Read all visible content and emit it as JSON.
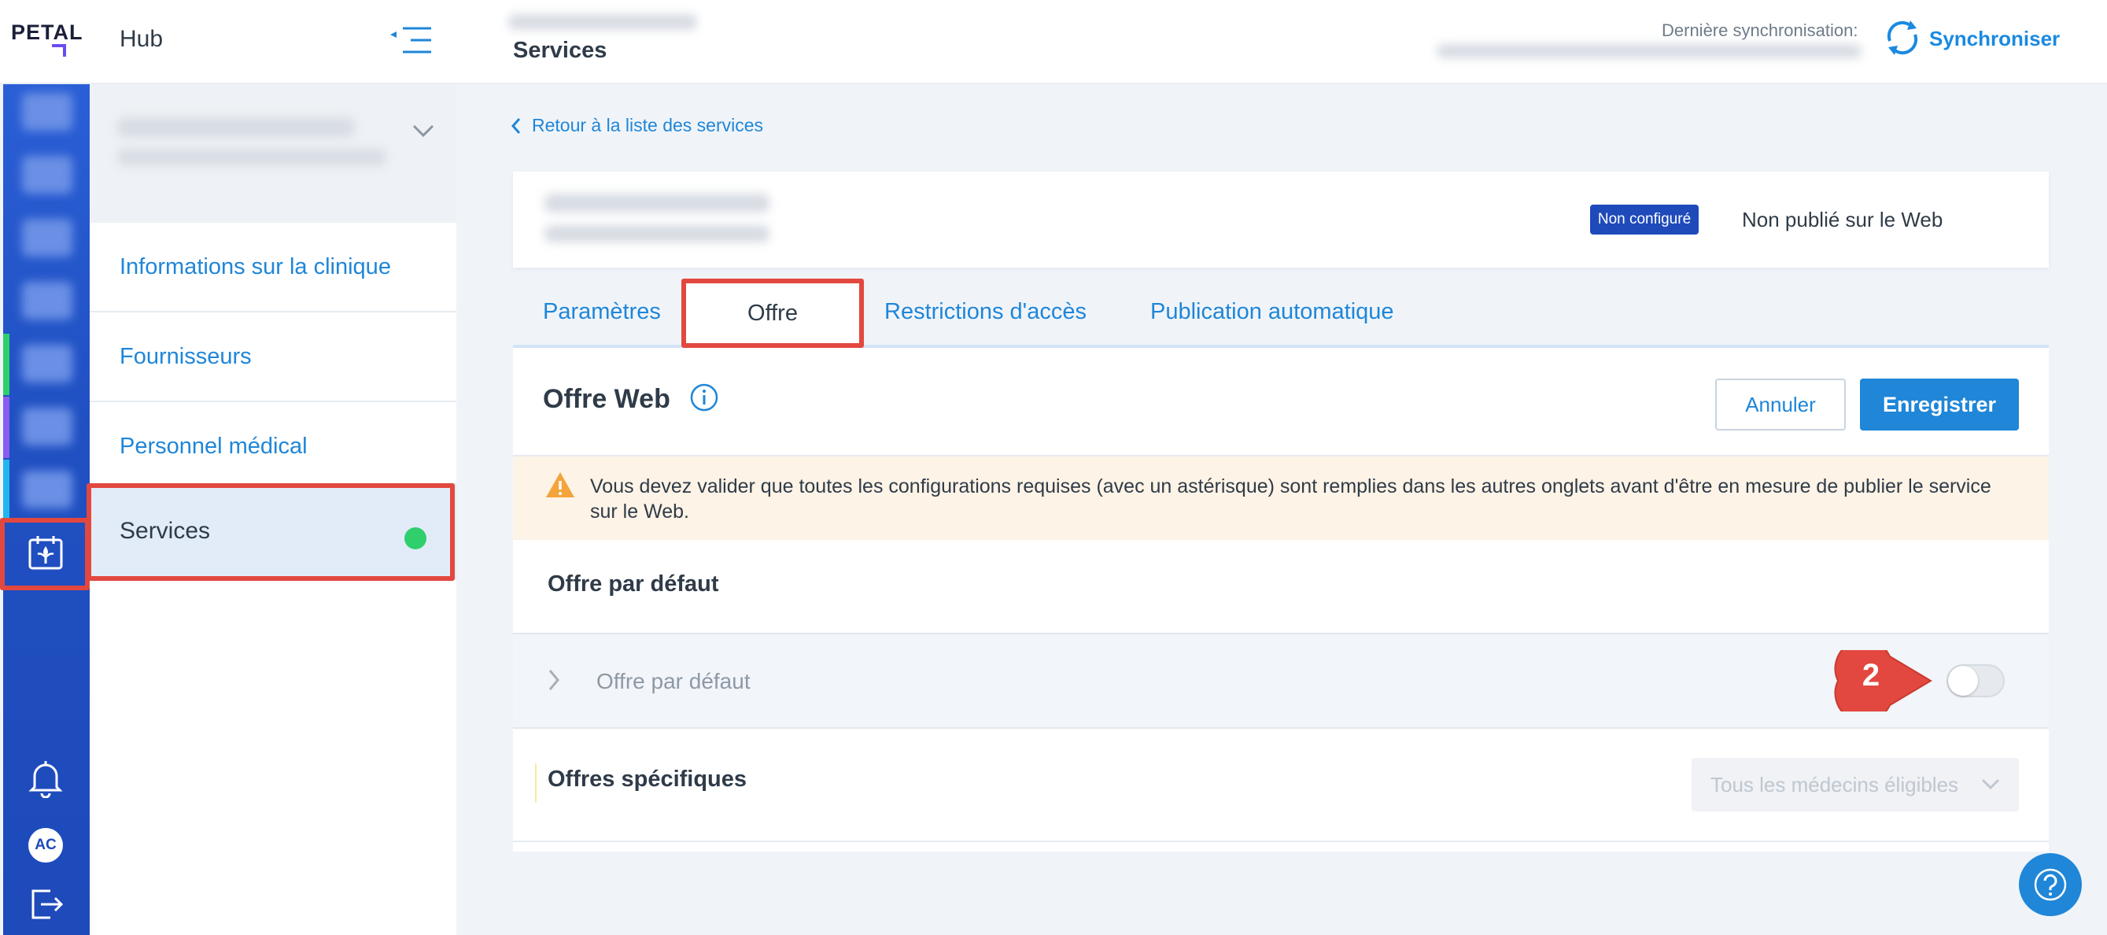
{
  "header": {
    "logo_text": "PETAL",
    "hub_title": "Hub",
    "page_heading": "Services",
    "last_sync_label": "Dernière synchronisation:",
    "sync_label": "Synchroniser"
  },
  "rail": {
    "avatar_initials": "AC",
    "icons": [
      "clinic-services-icon",
      "bell-icon",
      "logout-icon"
    ]
  },
  "sidebar": {
    "items": [
      {
        "label": "Informations sur la clinique"
      },
      {
        "label": "Fournisseurs"
      },
      {
        "label": "Personnel médical"
      },
      {
        "label": "Services",
        "active": true
      }
    ]
  },
  "main": {
    "back_link": "Retour à la liste des services",
    "status_badge": "Non configuré",
    "publish_status": "Non publié sur le Web",
    "tabs": [
      {
        "label": "Paramètres"
      },
      {
        "label": "Offre",
        "active": true
      },
      {
        "label": "Restrictions d'accès"
      },
      {
        "label": "Publication automatique"
      }
    ],
    "panel_title": "Offre Web",
    "cancel_label": "Annuler",
    "save_label": "Enregistrer",
    "warning_text": "Vous devez valider que toutes les configurations requises (avec un astérisque) sont remplies dans les autres onglets avant d'être en mesure de publier le service sur le Web.",
    "default_offer_heading": "Offre par défaut",
    "default_offer_row_label": "Offre  par défaut",
    "step_number": "2",
    "specific_offers_heading": "Offres spécifiques",
    "doctor_select_value": "Tous les médecins éligibles"
  },
  "colors": {
    "accent": "#1f86d8",
    "rail": "#1e4aba",
    "highlight": "#e2483f",
    "success": "#2fcf6b",
    "warning_bg": "#fdf3e6"
  }
}
